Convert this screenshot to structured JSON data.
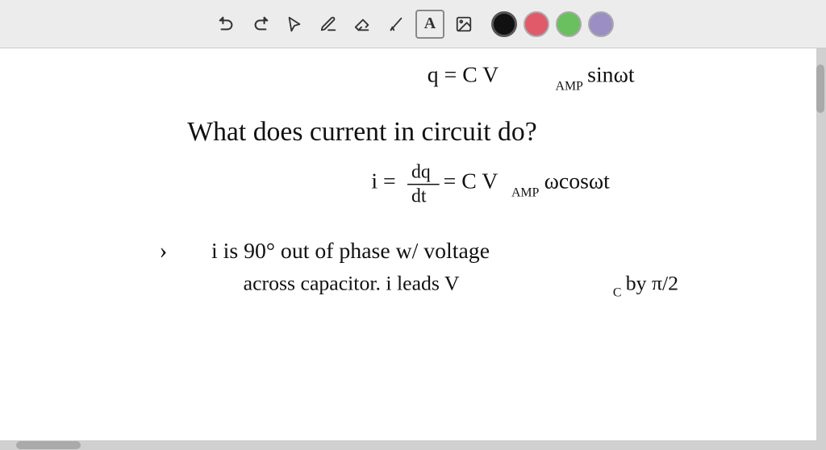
{
  "toolbar": {
    "tools": [
      {
        "name": "undo",
        "icon": "↩",
        "label": "Undo"
      },
      {
        "name": "redo",
        "icon": "↪",
        "label": "Redo"
      },
      {
        "name": "select",
        "icon": "⬆",
        "label": "Select"
      },
      {
        "name": "pen",
        "icon": "✏",
        "label": "Pen"
      },
      {
        "name": "eraser",
        "icon": "✂",
        "label": "Eraser"
      },
      {
        "name": "highlighter",
        "icon": "/",
        "label": "Highlighter"
      },
      {
        "name": "text",
        "icon": "A",
        "label": "Text"
      },
      {
        "name": "image",
        "icon": "🖼",
        "label": "Image"
      }
    ],
    "colors": [
      {
        "name": "black",
        "hex": "#111111",
        "selected": true
      },
      {
        "name": "red",
        "hex": "#e05a6a",
        "selected": false
      },
      {
        "name": "green",
        "hex": "#6abf5e",
        "selected": false
      },
      {
        "name": "purple",
        "hex": "#9b8ec4",
        "selected": false
      }
    ]
  },
  "canvas": {
    "background": "#ffffff",
    "content": {
      "line1": "q = C V_AMP sin ωt",
      "line2": "What does current in circuit do?",
      "line3": "i = dq/dt = C V_AMP ω cos ωt",
      "line4": "> i is 90° out of phase w/ voltage",
      "line5": "across capacitor. i leads V_C by π/2"
    }
  }
}
